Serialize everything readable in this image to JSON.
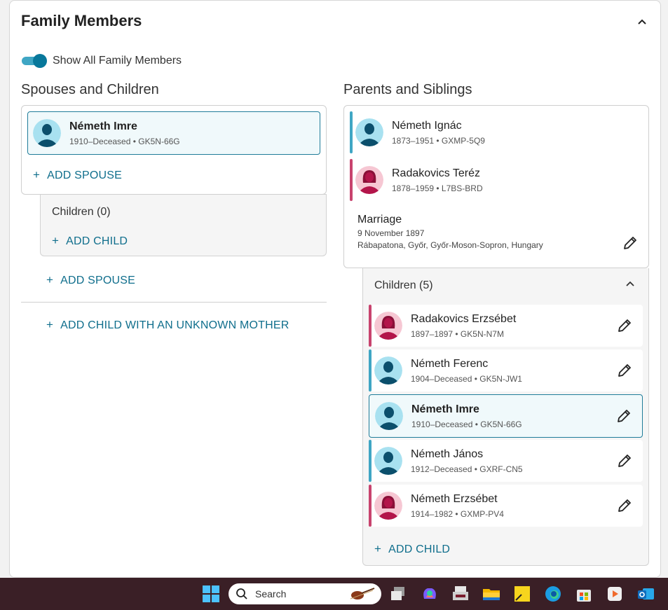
{
  "card": {
    "title": "Family Members"
  },
  "toggle": {
    "label": "Show All Family Members",
    "on": true
  },
  "spouses": {
    "heading": "Spouses and Children",
    "focus": {
      "name": "Németh Imre",
      "meta": "1910–Deceased • GK5N-66G"
    },
    "add_spouse_inner": "ADD SPOUSE",
    "children_label": "Children (0)",
    "add_child": "ADD CHILD",
    "add_spouse_outer": "ADD SPOUSE",
    "add_child_unknown": "ADD CHILD WITH AN UNKNOWN MOTHER"
  },
  "parents": {
    "heading": "Parents and Siblings",
    "father": {
      "name": "Németh Ignác",
      "meta": "1873–1951 • GXMP-5Q9"
    },
    "mother": {
      "name": "Radakovics Teréz",
      "meta": "1878–1959 • L7BS-BRD"
    },
    "marriage": {
      "title": "Marriage",
      "date": "9 November 1897",
      "place": "Rábapatona, Győr, Győr-Moson-Sopron, Hungary"
    },
    "children_label": "Children (5)",
    "children": [
      {
        "name": "Radakovics Erzsébet",
        "meta": "1897–1897 • GK5N-N7M"
      },
      {
        "name": "Németh Ferenc",
        "meta": "1904–Deceased • GK5N-JW1"
      },
      {
        "name": "Németh Imre",
        "meta": "1910–Deceased • GK5N-66G"
      },
      {
        "name": "Németh János",
        "meta": "1912–Deceased • GXRF-CN5"
      },
      {
        "name": "Németh Erzsébet",
        "meta": "1914–1982 • GXMP-PV4"
      }
    ],
    "add_child": "ADD CHILD"
  },
  "taskbar": {
    "search_placeholder": "Search"
  },
  "colors": {
    "male_accent": "#3fa6c4",
    "female_accent": "#c8436e",
    "link": "#0f6e8c",
    "selected_border": "#1f7c99"
  },
  "icons": [
    "chevron-up-icon",
    "plus-icon",
    "pencil-icon",
    "male-avatar-icon",
    "female-avatar-icon",
    "windows-start-icon",
    "search-icon"
  ]
}
